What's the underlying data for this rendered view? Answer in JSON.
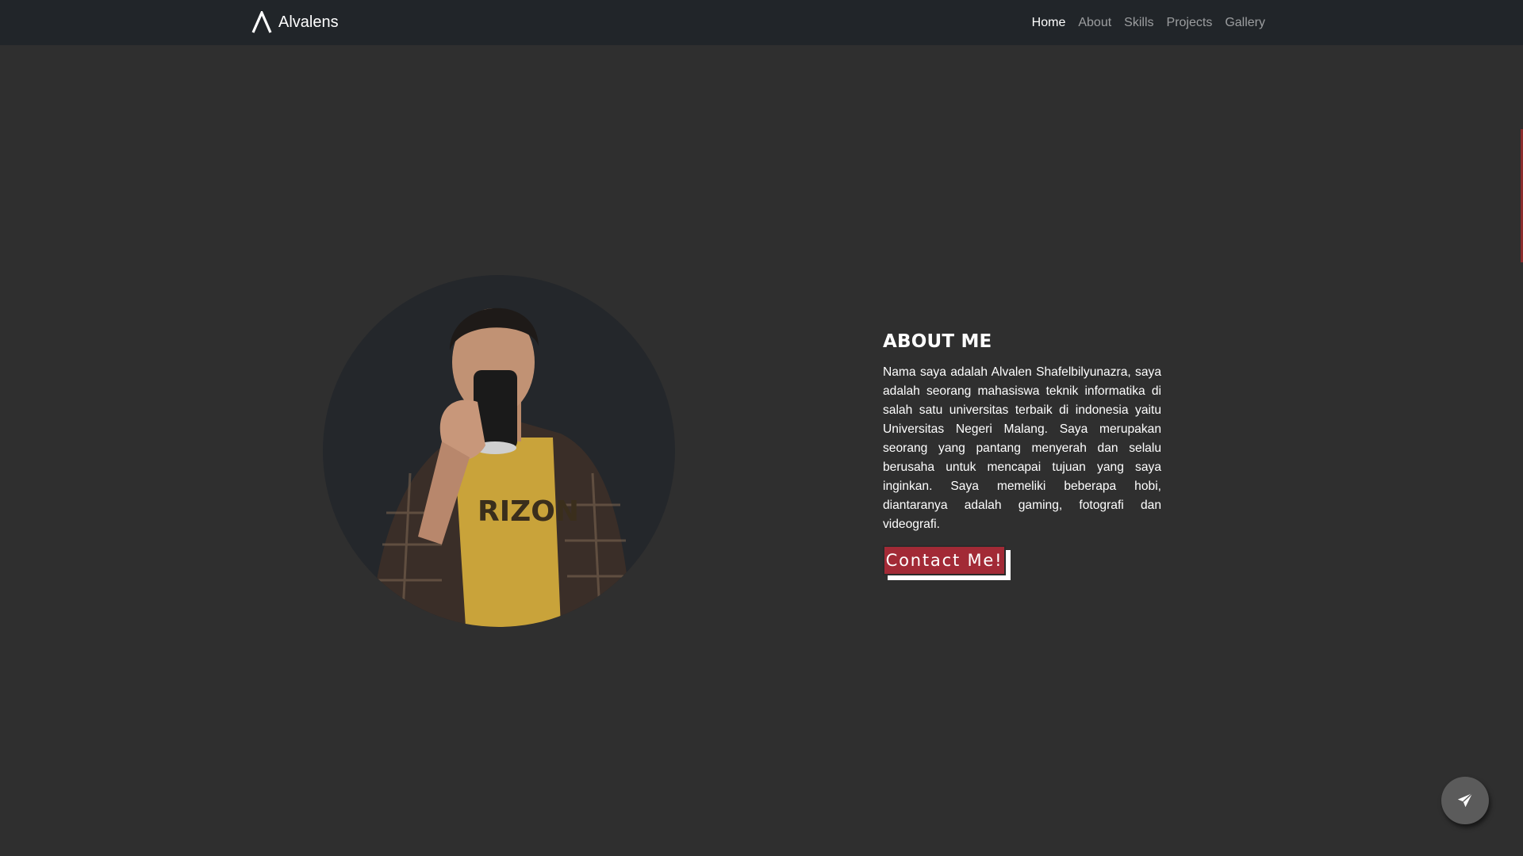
{
  "navbar": {
    "brand": "Alvalens",
    "links": [
      {
        "label": "Home",
        "active": true
      },
      {
        "label": "About",
        "active": false
      },
      {
        "label": "Skills",
        "active": false
      },
      {
        "label": "Projects",
        "active": false
      },
      {
        "label": "Gallery",
        "active": false
      }
    ]
  },
  "about": {
    "title": "ABOUT ME",
    "text": "Nama saya adalah Alvalen Shafelbilyunazra, saya adalah seorang mahasiswa teknik informatika di salah satu universitas terbaik di indonesia yaitu Universitas Negeri Malang. Saya merupakan seorang yang pantang menyerah dan selalu berusaha untuk mencapai tujuan yang saya inginkan. Saya memeliki beberapa hobi, diantaranya adalah gaming, fotografi dan videografi.",
    "button_label": "Contact Me!"
  },
  "portrait": {
    "shirt_text": "RIZON"
  },
  "icons": {
    "brand": "alvalens-logo-icon",
    "fab": "paper-plane-icon"
  },
  "colors": {
    "page_background": "#2f2f2f",
    "navbar_background": "#212529",
    "accent": "#a22a36",
    "fab_background": "#5b5b5b"
  }
}
